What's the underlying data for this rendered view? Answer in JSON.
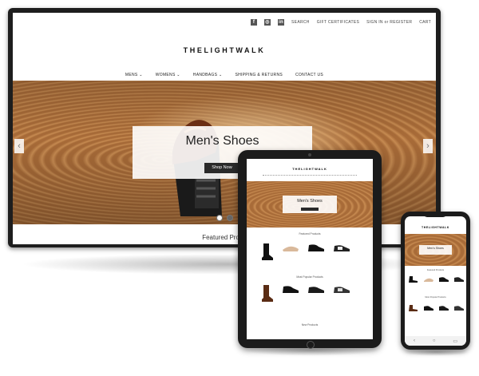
{
  "desktop": {
    "social_icons": [
      "facebook-icon",
      "instagram-icon",
      "linkedin-icon"
    ],
    "utility": {
      "search": "SEARCH",
      "gift": "GIFT CERTIFICATES",
      "signin": "SIGN IN",
      "or": "or",
      "register": "REGISTER",
      "cart": "CART"
    },
    "brand": "THELIGHTWALK",
    "nav": [
      "MENS ⌄",
      "WOMENS ⌄",
      "HANDBAGS ⌄",
      "SHIPPING & RETURNS",
      "CONTACT US"
    ],
    "hero_title": "Men's Shoes",
    "shop_button": "Shop Now",
    "prev_arrow": "‹",
    "next_arrow": "›",
    "featured_heading": "Featured Produ"
  },
  "tablet": {
    "brand": "THELIGHTWALK",
    "hero_title": "Men's Shoes",
    "section1": "Featured Products",
    "section2": "Most Popular Products",
    "section3": "New Products"
  },
  "phone": {
    "brand": "THELIGHTWALK",
    "hero_title": "Men's Shoes",
    "section1": "Featured Products",
    "section2": "Most Popular Products"
  },
  "colors": {
    "bezel": "#1e1e1e",
    "leather": "#a86b38",
    "button": "#2a2a2a"
  }
}
